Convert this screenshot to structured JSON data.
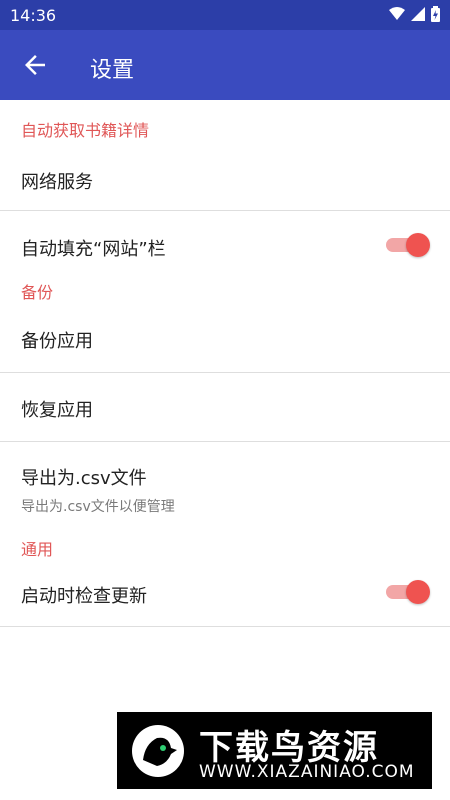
{
  "status_bar": {
    "time": "14:36"
  },
  "app_bar": {
    "title": "设置"
  },
  "sections": {
    "auto_fetch": {
      "header": "自动获取书籍详情",
      "network_service": "网络服务",
      "auto_fill": "自动填充“网站”栏",
      "auto_fill_enabled": true
    },
    "backup": {
      "header": "备份",
      "backup_app": "备份应用",
      "restore_app": "恢复应用",
      "export_csv": "导出为.csv文件",
      "export_csv_sub": "导出为.csv文件以便管理"
    },
    "general": {
      "header": "通用",
      "check_update": "启动时检查更新",
      "check_update_enabled": true
    }
  },
  "watermark": {
    "text": "下载鸟资源",
    "url": "WWW.XIAZAINIAO.COM"
  },
  "colors": {
    "status_bar": "#2c3ea8",
    "app_bar": "#3a4bbf",
    "section": "#e05757",
    "switch_thumb": "#ef5350",
    "switch_track": "#f2a6a6"
  }
}
